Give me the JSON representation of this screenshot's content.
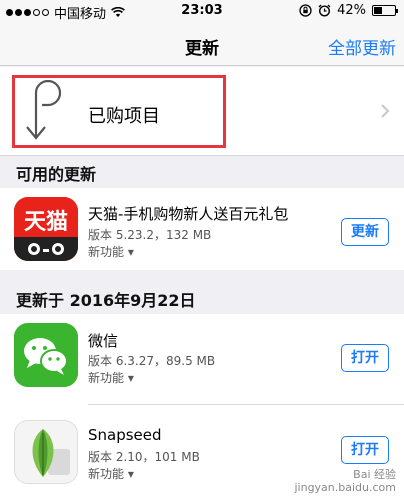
{
  "status_bar": {
    "carrier": "中国移动",
    "time": "23:03",
    "battery": "42%",
    "battery_level": 0.42
  },
  "nav": {
    "title": "更新",
    "action_label": "全部更新"
  },
  "purchased": {
    "label": "已购项目"
  },
  "available_section": {
    "header": "可用的更新",
    "apps": [
      {
        "name": "天猫-手机购物新人送百元礼包",
        "version": "版本 5.23.2，132 MB",
        "whats_new": "新功能 ▾",
        "button": "更新",
        "icon": "tmall-icon"
      }
    ]
  },
  "updated_section": {
    "header": "更新于 2016年9月22日",
    "apps": [
      {
        "name": "微信",
        "version": "版本 6.3.27，89.5 MB",
        "whats_new": "新功能 ▾",
        "button": "打开",
        "icon": "wechat-icon"
      },
      {
        "name": "Snapseed",
        "version": "版本 2.10，101 MB",
        "whats_new": "新功能 ▾",
        "button": "打开",
        "icon": "snapseed-icon"
      }
    ]
  },
  "watermark": {
    "line1": "Bai 经验",
    "line2": "jingyan.baidu.com"
  },
  "colors": {
    "accent": "#1a7cf6",
    "highlight": "#e4373d",
    "tmall_red": "#e8231c",
    "wechat_green": "#3bb52f"
  }
}
